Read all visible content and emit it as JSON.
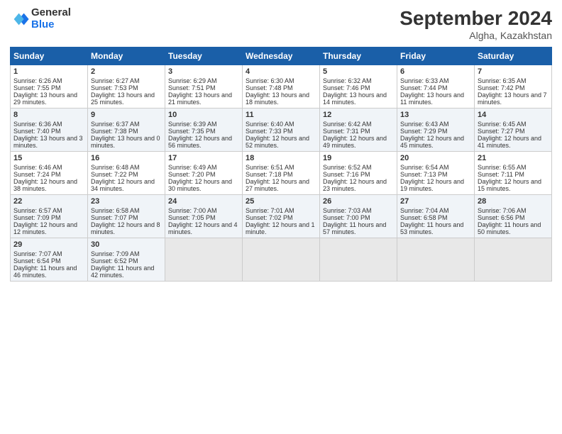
{
  "header": {
    "logo_general": "General",
    "logo_blue": "Blue",
    "month_title": "September 2024",
    "location": "Algha, Kazakhstan"
  },
  "columns": [
    "Sunday",
    "Monday",
    "Tuesday",
    "Wednesday",
    "Thursday",
    "Friday",
    "Saturday"
  ],
  "weeks": [
    [
      {
        "day": "1",
        "sunrise": "Sunrise: 6:26 AM",
        "sunset": "Sunset: 7:55 PM",
        "daylight": "Daylight: 13 hours and 29 minutes."
      },
      {
        "day": "2",
        "sunrise": "Sunrise: 6:27 AM",
        "sunset": "Sunset: 7:53 PM",
        "daylight": "Daylight: 13 hours and 25 minutes."
      },
      {
        "day": "3",
        "sunrise": "Sunrise: 6:29 AM",
        "sunset": "Sunset: 7:51 PM",
        "daylight": "Daylight: 13 hours and 21 minutes."
      },
      {
        "day": "4",
        "sunrise": "Sunrise: 6:30 AM",
        "sunset": "Sunset: 7:48 PM",
        "daylight": "Daylight: 13 hours and 18 minutes."
      },
      {
        "day": "5",
        "sunrise": "Sunrise: 6:32 AM",
        "sunset": "Sunset: 7:46 PM",
        "daylight": "Daylight: 13 hours and 14 minutes."
      },
      {
        "day": "6",
        "sunrise": "Sunrise: 6:33 AM",
        "sunset": "Sunset: 7:44 PM",
        "daylight": "Daylight: 13 hours and 11 minutes."
      },
      {
        "day": "7",
        "sunrise": "Sunrise: 6:35 AM",
        "sunset": "Sunset: 7:42 PM",
        "daylight": "Daylight: 13 hours and 7 minutes."
      }
    ],
    [
      {
        "day": "8",
        "sunrise": "Sunrise: 6:36 AM",
        "sunset": "Sunset: 7:40 PM",
        "daylight": "Daylight: 13 hours and 3 minutes."
      },
      {
        "day": "9",
        "sunrise": "Sunrise: 6:37 AM",
        "sunset": "Sunset: 7:38 PM",
        "daylight": "Daylight: 13 hours and 0 minutes."
      },
      {
        "day": "10",
        "sunrise": "Sunrise: 6:39 AM",
        "sunset": "Sunset: 7:35 PM",
        "daylight": "Daylight: 12 hours and 56 minutes."
      },
      {
        "day": "11",
        "sunrise": "Sunrise: 6:40 AM",
        "sunset": "Sunset: 7:33 PM",
        "daylight": "Daylight: 12 hours and 52 minutes."
      },
      {
        "day": "12",
        "sunrise": "Sunrise: 6:42 AM",
        "sunset": "Sunset: 7:31 PM",
        "daylight": "Daylight: 12 hours and 49 minutes."
      },
      {
        "day": "13",
        "sunrise": "Sunrise: 6:43 AM",
        "sunset": "Sunset: 7:29 PM",
        "daylight": "Daylight: 12 hours and 45 minutes."
      },
      {
        "day": "14",
        "sunrise": "Sunrise: 6:45 AM",
        "sunset": "Sunset: 7:27 PM",
        "daylight": "Daylight: 12 hours and 41 minutes."
      }
    ],
    [
      {
        "day": "15",
        "sunrise": "Sunrise: 6:46 AM",
        "sunset": "Sunset: 7:24 PM",
        "daylight": "Daylight: 12 hours and 38 minutes."
      },
      {
        "day": "16",
        "sunrise": "Sunrise: 6:48 AM",
        "sunset": "Sunset: 7:22 PM",
        "daylight": "Daylight: 12 hours and 34 minutes."
      },
      {
        "day": "17",
        "sunrise": "Sunrise: 6:49 AM",
        "sunset": "Sunset: 7:20 PM",
        "daylight": "Daylight: 12 hours and 30 minutes."
      },
      {
        "day": "18",
        "sunrise": "Sunrise: 6:51 AM",
        "sunset": "Sunset: 7:18 PM",
        "daylight": "Daylight: 12 hours and 27 minutes."
      },
      {
        "day": "19",
        "sunrise": "Sunrise: 6:52 AM",
        "sunset": "Sunset: 7:16 PM",
        "daylight": "Daylight: 12 hours and 23 minutes."
      },
      {
        "day": "20",
        "sunrise": "Sunrise: 6:54 AM",
        "sunset": "Sunset: 7:13 PM",
        "daylight": "Daylight: 12 hours and 19 minutes."
      },
      {
        "day": "21",
        "sunrise": "Sunrise: 6:55 AM",
        "sunset": "Sunset: 7:11 PM",
        "daylight": "Daylight: 12 hours and 15 minutes."
      }
    ],
    [
      {
        "day": "22",
        "sunrise": "Sunrise: 6:57 AM",
        "sunset": "Sunset: 7:09 PM",
        "daylight": "Daylight: 12 hours and 12 minutes."
      },
      {
        "day": "23",
        "sunrise": "Sunrise: 6:58 AM",
        "sunset": "Sunset: 7:07 PM",
        "daylight": "Daylight: 12 hours and 8 minutes."
      },
      {
        "day": "24",
        "sunrise": "Sunrise: 7:00 AM",
        "sunset": "Sunset: 7:05 PM",
        "daylight": "Daylight: 12 hours and 4 minutes."
      },
      {
        "day": "25",
        "sunrise": "Sunrise: 7:01 AM",
        "sunset": "Sunset: 7:02 PM",
        "daylight": "Daylight: 12 hours and 1 minute."
      },
      {
        "day": "26",
        "sunrise": "Sunrise: 7:03 AM",
        "sunset": "Sunset: 7:00 PM",
        "daylight": "Daylight: 11 hours and 57 minutes."
      },
      {
        "day": "27",
        "sunrise": "Sunrise: 7:04 AM",
        "sunset": "Sunset: 6:58 PM",
        "daylight": "Daylight: 11 hours and 53 minutes."
      },
      {
        "day": "28",
        "sunrise": "Sunrise: 7:06 AM",
        "sunset": "Sunset: 6:56 PM",
        "daylight": "Daylight: 11 hours and 50 minutes."
      }
    ],
    [
      {
        "day": "29",
        "sunrise": "Sunrise: 7:07 AM",
        "sunset": "Sunset: 6:54 PM",
        "daylight": "Daylight: 11 hours and 46 minutes."
      },
      {
        "day": "30",
        "sunrise": "Sunrise: 7:09 AM",
        "sunset": "Sunset: 6:52 PM",
        "daylight": "Daylight: 11 hours and 42 minutes."
      },
      {
        "day": "",
        "sunrise": "",
        "sunset": "",
        "daylight": ""
      },
      {
        "day": "",
        "sunrise": "",
        "sunset": "",
        "daylight": ""
      },
      {
        "day": "",
        "sunrise": "",
        "sunset": "",
        "daylight": ""
      },
      {
        "day": "",
        "sunrise": "",
        "sunset": "",
        "daylight": ""
      },
      {
        "day": "",
        "sunrise": "",
        "sunset": "",
        "daylight": ""
      }
    ]
  ]
}
